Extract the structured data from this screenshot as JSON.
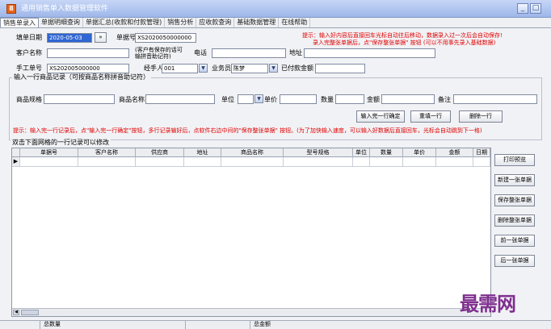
{
  "window": {
    "title": "通用销售单入数据管理软件",
    "app_icon": "8",
    "minimize": "_",
    "maximize": "□"
  },
  "tabs": [
    "销售单录入",
    "单据明细查询",
    "单据汇总(收款和付款管理)",
    "销售分析",
    "应收款查询",
    "基础数据管理",
    "在线帮助"
  ],
  "form": {
    "date_label": "填单日期",
    "date_value": "2020-05-03",
    "date_btn": "»",
    "bill_label": "单据号",
    "bill_value": "XS2020050000000",
    "customer_label": "客户名称",
    "customer_note": "(客户有保存的话可输拼音助记符)",
    "phone_label": "电话",
    "address_label": "地址",
    "manual_label": "手工单号",
    "manual_value": "XS202005000000",
    "handler_label": "经手人",
    "handler_value": "001",
    "salesman_label": "业务员",
    "salesman_value": "陈梦",
    "paid_label": "已付款金额"
  },
  "hints": {
    "top1": "提示：输入好内容后直接回车光标自动往后移动，数据录入过一次后会自动保存!",
    "top2": "录入完整张单据后，点\"保存整张单据\" 按钮 (可以不用事先录入基础数据)",
    "bottom": "提示：输入完一行记录后，点\"输入完一行确定\"按钮，多行记录输好后，点软件右边中间的\"保存整张单据\" 按钮。(为了加快输入速度，可以输入好数据后直接回车，光标会自动跳到下一格)"
  },
  "entry": {
    "title": "输入一行商品记录（可按商品名称拼音助记符）",
    "spec_label": "商品规格",
    "name_label": "商品名称",
    "unit_label": "单位",
    "price_label": "单价",
    "qty_label": "数量",
    "amount_label": "金额",
    "remark_label": "备注",
    "confirm_btn": "输入完一行确定",
    "clear_btn": "重填一行",
    "delete_btn": "删除一行"
  },
  "grid": {
    "title": "双击下面网格的一行记录可以修改",
    "columns": [
      "单据号",
      "客户名称",
      "供应商",
      "地址",
      "商品名称",
      "型号规格",
      "单位",
      "数量",
      "单价",
      "金额",
      "日期"
    ]
  },
  "side_buttons": [
    "打印预览",
    "新建一张单据",
    "保存整张单据",
    "删除整张单据",
    "前一张单据",
    "后一张单据"
  ],
  "status": {
    "total_qty": "总数量",
    "total_amount": "总金额"
  },
  "watermark": "最需网",
  "colors": {
    "hint": "#e00000",
    "title_blue": "#9eb7e9",
    "selection": "#2f66d4",
    "watermark": "#7f2f8f"
  }
}
